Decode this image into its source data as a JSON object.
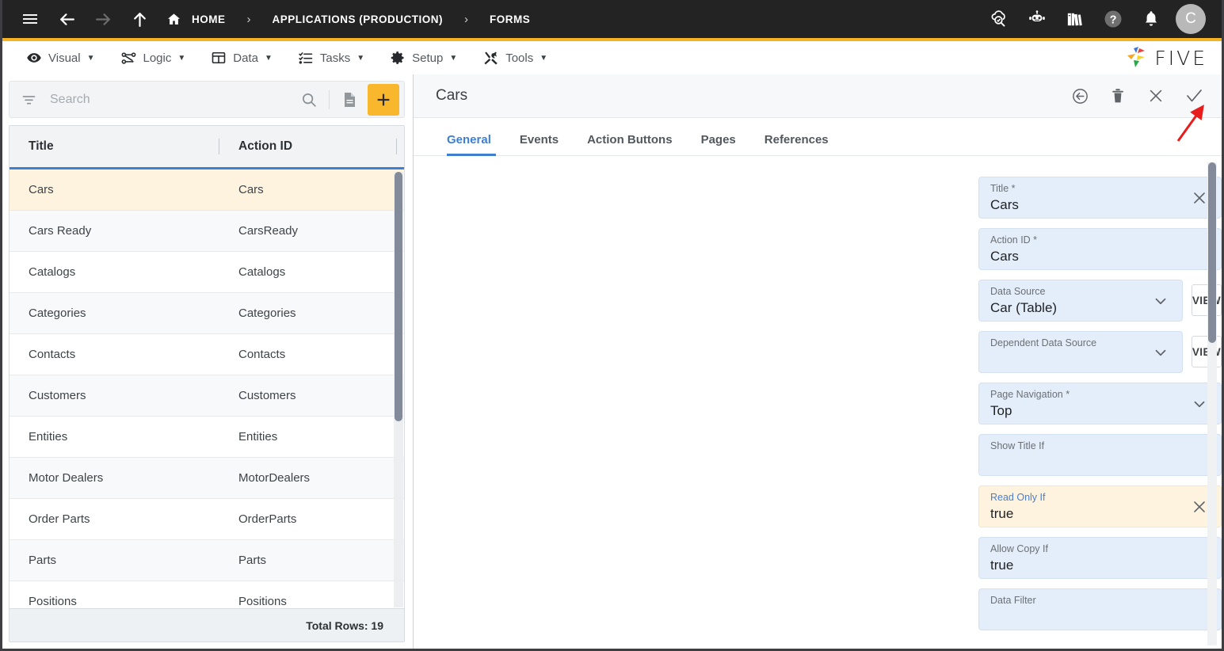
{
  "topbar": {
    "menu_icon": "hamburger-icon",
    "back_icon": "arrow-left-icon",
    "forward_icon": "arrow-right-icon",
    "up_icon": "arrow-up-icon",
    "home_label": "HOME",
    "sep": "›",
    "breadcrumb_app": "APPLICATIONS (PRODUCTION)",
    "breadcrumb_current": "FORMS",
    "avatar_initial": "C",
    "icons": [
      "cloud-check-search-icon",
      "robot-icon",
      "books-icon",
      "help-icon",
      "bell-icon"
    ],
    "bg": "#232323",
    "accent": "#f5b323"
  },
  "menubar": {
    "items": [
      {
        "label": "Visual",
        "icon": "eye-icon",
        "caret": "▼"
      },
      {
        "label": "Logic",
        "icon": "logic-nodes-icon",
        "caret": "▼"
      },
      {
        "label": "Data",
        "icon": "table-icon",
        "caret": "▼"
      },
      {
        "label": "Tasks",
        "icon": "checklist-icon",
        "caret": "▼"
      },
      {
        "label": "Setup",
        "icon": "gear-icon",
        "caret": "▼"
      },
      {
        "label": "Tools",
        "icon": "tools-icon",
        "caret": "▼"
      }
    ],
    "brand": "FIVE"
  },
  "left_panel": {
    "search": {
      "placeholder": "Search",
      "value": ""
    },
    "toolbar": {
      "filter_icon": "filter-icon",
      "search_icon": "search-icon",
      "document_icon": "document-icon",
      "add_icon": "plus-icon"
    },
    "columns": [
      "Title",
      "Action ID"
    ],
    "rows": [
      {
        "title": "Cars",
        "action_id": "Cars"
      },
      {
        "title": "Cars Ready",
        "action_id": "CarsReady"
      },
      {
        "title": "Catalogs",
        "action_id": "Catalogs"
      },
      {
        "title": "Categories",
        "action_id": "Categories"
      },
      {
        "title": "Contacts",
        "action_id": "Contacts"
      },
      {
        "title": "Customers",
        "action_id": "Customers"
      },
      {
        "title": "Entities",
        "action_id": "Entities"
      },
      {
        "title": "Motor Dealers",
        "action_id": "MotorDealers"
      },
      {
        "title": "Order Parts",
        "action_id": "OrderParts"
      },
      {
        "title": "Parts",
        "action_id": "Parts"
      },
      {
        "title": "Positions",
        "action_id": "Positions"
      }
    ],
    "selected_index": 0,
    "footer": "Total Rows: 19"
  },
  "right_panel": {
    "title": "Cars",
    "header_icons": [
      {
        "name": "undo-arrow-icon"
      },
      {
        "name": "delete-trash-icon"
      },
      {
        "name": "close-icon"
      },
      {
        "name": "save-check-icon"
      }
    ],
    "tabs": [
      {
        "label": "General",
        "active": true
      },
      {
        "label": "Events",
        "active": false
      },
      {
        "label": "Action Buttons",
        "active": false
      },
      {
        "label": "Pages",
        "active": false
      },
      {
        "label": "References",
        "active": false
      }
    ],
    "fields": [
      {
        "label": "Title *",
        "value": "Cars",
        "control": "clear",
        "highlight": false,
        "view_button": null
      },
      {
        "label": "Action ID *",
        "value": "Cars",
        "control": "none",
        "highlight": false,
        "view_button": null
      },
      {
        "label": "Data Source",
        "value": "Car (Table)",
        "control": "chevron",
        "highlight": false,
        "view_button": "VIEW"
      },
      {
        "label": "Dependent Data Source",
        "value": "",
        "control": "chevron",
        "highlight": false,
        "view_button": "VIEW"
      },
      {
        "label": "Page Navigation *",
        "value": "Top",
        "control": "chevron",
        "highlight": false,
        "view_button": null
      },
      {
        "label": "Show Title If",
        "value": "",
        "control": "none",
        "highlight": false,
        "view_button": null
      },
      {
        "label": "Read Only If",
        "value": "true",
        "control": "clear",
        "highlight": true,
        "view_button": null
      },
      {
        "label": "Allow Copy If",
        "value": "true",
        "control": "none",
        "highlight": false,
        "view_button": null
      },
      {
        "label": "Data Filter",
        "value": "",
        "control": "none",
        "highlight": false,
        "view_button": null
      }
    ]
  },
  "annotation": {
    "type": "red-arrow",
    "color": "#e81c1c",
    "points_to": "save-check-icon"
  }
}
